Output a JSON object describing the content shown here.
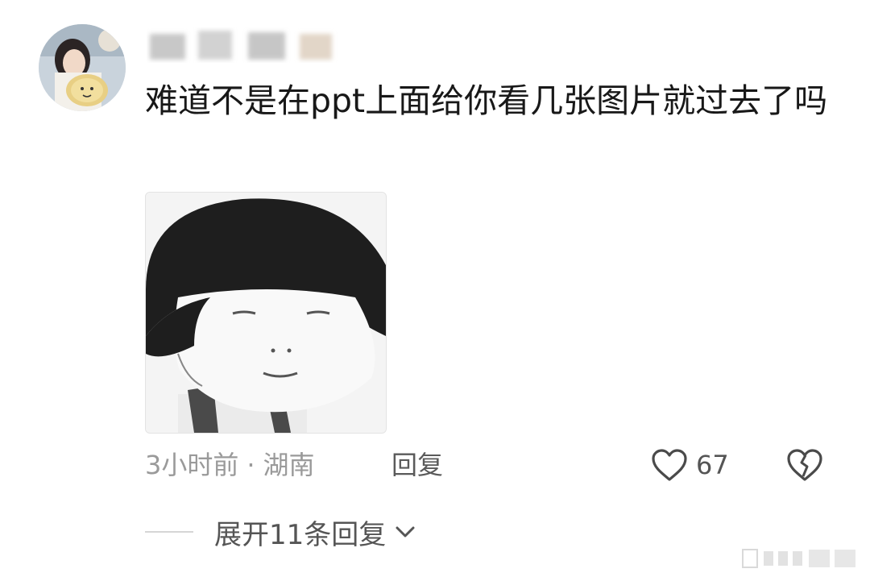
{
  "comment": {
    "text": "难道不是在ppt上面给你看几张图片就过去了吗",
    "time": "3小时前",
    "separator": "·",
    "location": "湖南",
    "reply_label": "回复",
    "like_count": "67",
    "expand_label": "展开11条回复"
  },
  "icons": {
    "like": "heart-outline-icon",
    "dislike": "broken-heart-icon",
    "expand": "chevron-down-icon"
  },
  "colors": {
    "text_primary": "#181818",
    "text_secondary": "#9a9a9a",
    "action_text": "#555555"
  }
}
